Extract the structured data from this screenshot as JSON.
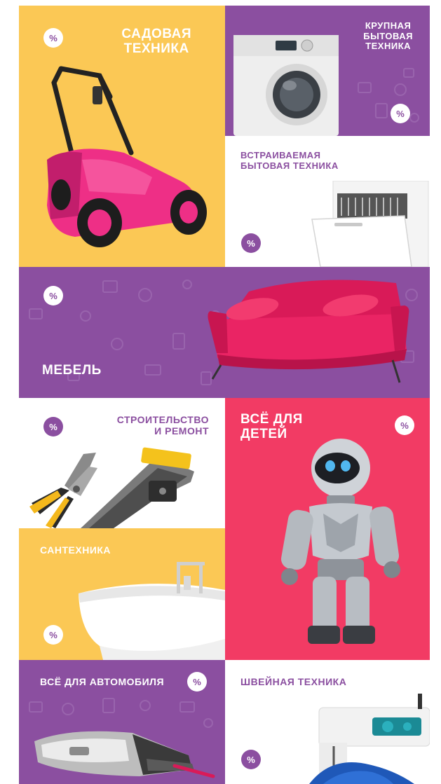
{
  "badge_symbol": "%",
  "colors": {
    "yellow": "#fbc855",
    "purple": "#8b4fa0",
    "pink": "#f23b64",
    "white": "#ffffff"
  },
  "tiles": {
    "garden": {
      "lines": [
        "САДОВАЯ",
        "ТЕХНИКА"
      ],
      "icon": "lawn-mower-icon"
    },
    "large_appliances": {
      "lines": [
        "КРУПНАЯ",
        "БЫТОВАЯ",
        "ТЕХНИКА"
      ],
      "icon": "washing-machine-icon"
    },
    "builtin": {
      "lines": [
        "ВСТРАИВАЕМАЯ",
        "БЫТОВАЯ ТЕХНИКА"
      ],
      "icon": "dishwasher-icon"
    },
    "furniture": {
      "lines": [
        "МЕБЕЛЬ"
      ],
      "icon": "sofa-icon"
    },
    "construction": {
      "lines": [
        "СТРОИТЕЛЬСТВО",
        "И РЕМОНТ"
      ],
      "icon": "pliers-stapler-icon"
    },
    "kids": {
      "lines": [
        "ВСЁ ДЛЯ",
        "ДЕТЕЙ"
      ],
      "icon": "robot-toy-icon"
    },
    "plumbing": {
      "lines": [
        "САНТЕХНИКА"
      ],
      "icon": "bathtub-icon"
    },
    "auto": {
      "lines": [
        "ВСЁ ДЛЯ АВТОМОБИЛЯ"
      ],
      "icon": "car-vacuum-icon"
    },
    "sewing": {
      "lines": [
        "ШВЕЙНАЯ ТЕХНИКА"
      ],
      "icon": "sewing-machine-icon"
    }
  }
}
